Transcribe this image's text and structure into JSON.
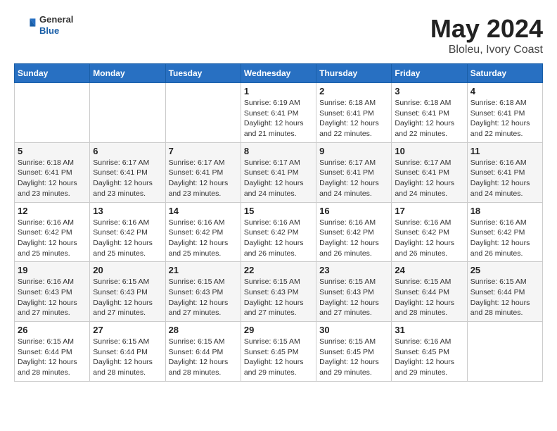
{
  "header": {
    "logo_general": "General",
    "logo_blue": "Blue",
    "title": "May 2024",
    "location": "Bloleu, Ivory Coast"
  },
  "weekdays": [
    "Sunday",
    "Monday",
    "Tuesday",
    "Wednesday",
    "Thursday",
    "Friday",
    "Saturday"
  ],
  "weeks": [
    [
      null,
      null,
      null,
      {
        "day": 1,
        "sunrise": "6:19 AM",
        "sunset": "6:41 PM",
        "daylight": "12 hours and 21 minutes."
      },
      {
        "day": 2,
        "sunrise": "6:18 AM",
        "sunset": "6:41 PM",
        "daylight": "12 hours and 22 minutes."
      },
      {
        "day": 3,
        "sunrise": "6:18 AM",
        "sunset": "6:41 PM",
        "daylight": "12 hours and 22 minutes."
      },
      {
        "day": 4,
        "sunrise": "6:18 AM",
        "sunset": "6:41 PM",
        "daylight": "12 hours and 22 minutes."
      }
    ],
    [
      {
        "day": 5,
        "sunrise": "6:18 AM",
        "sunset": "6:41 PM",
        "daylight": "12 hours and 23 minutes."
      },
      {
        "day": 6,
        "sunrise": "6:17 AM",
        "sunset": "6:41 PM",
        "daylight": "12 hours and 23 minutes."
      },
      {
        "day": 7,
        "sunrise": "6:17 AM",
        "sunset": "6:41 PM",
        "daylight": "12 hours and 23 minutes."
      },
      {
        "day": 8,
        "sunrise": "6:17 AM",
        "sunset": "6:41 PM",
        "daylight": "12 hours and 24 minutes."
      },
      {
        "day": 9,
        "sunrise": "6:17 AM",
        "sunset": "6:41 PM",
        "daylight": "12 hours and 24 minutes."
      },
      {
        "day": 10,
        "sunrise": "6:17 AM",
        "sunset": "6:41 PM",
        "daylight": "12 hours and 24 minutes."
      },
      {
        "day": 11,
        "sunrise": "6:16 AM",
        "sunset": "6:41 PM",
        "daylight": "12 hours and 24 minutes."
      }
    ],
    [
      {
        "day": 12,
        "sunrise": "6:16 AM",
        "sunset": "6:42 PM",
        "daylight": "12 hours and 25 minutes."
      },
      {
        "day": 13,
        "sunrise": "6:16 AM",
        "sunset": "6:42 PM",
        "daylight": "12 hours and 25 minutes."
      },
      {
        "day": 14,
        "sunrise": "6:16 AM",
        "sunset": "6:42 PM",
        "daylight": "12 hours and 25 minutes."
      },
      {
        "day": 15,
        "sunrise": "6:16 AM",
        "sunset": "6:42 PM",
        "daylight": "12 hours and 26 minutes."
      },
      {
        "day": 16,
        "sunrise": "6:16 AM",
        "sunset": "6:42 PM",
        "daylight": "12 hours and 26 minutes."
      },
      {
        "day": 17,
        "sunrise": "6:16 AM",
        "sunset": "6:42 PM",
        "daylight": "12 hours and 26 minutes."
      },
      {
        "day": 18,
        "sunrise": "6:16 AM",
        "sunset": "6:42 PM",
        "daylight": "12 hours and 26 minutes."
      }
    ],
    [
      {
        "day": 19,
        "sunrise": "6:16 AM",
        "sunset": "6:43 PM",
        "daylight": "12 hours and 27 minutes."
      },
      {
        "day": 20,
        "sunrise": "6:15 AM",
        "sunset": "6:43 PM",
        "daylight": "12 hours and 27 minutes."
      },
      {
        "day": 21,
        "sunrise": "6:15 AM",
        "sunset": "6:43 PM",
        "daylight": "12 hours and 27 minutes."
      },
      {
        "day": 22,
        "sunrise": "6:15 AM",
        "sunset": "6:43 PM",
        "daylight": "12 hours and 27 minutes."
      },
      {
        "day": 23,
        "sunrise": "6:15 AM",
        "sunset": "6:43 PM",
        "daylight": "12 hours and 27 minutes."
      },
      {
        "day": 24,
        "sunrise": "6:15 AM",
        "sunset": "6:44 PM",
        "daylight": "12 hours and 28 minutes."
      },
      {
        "day": 25,
        "sunrise": "6:15 AM",
        "sunset": "6:44 PM",
        "daylight": "12 hours and 28 minutes."
      }
    ],
    [
      {
        "day": 26,
        "sunrise": "6:15 AM",
        "sunset": "6:44 PM",
        "daylight": "12 hours and 28 minutes."
      },
      {
        "day": 27,
        "sunrise": "6:15 AM",
        "sunset": "6:44 PM",
        "daylight": "12 hours and 28 minutes."
      },
      {
        "day": 28,
        "sunrise": "6:15 AM",
        "sunset": "6:44 PM",
        "daylight": "12 hours and 28 minutes."
      },
      {
        "day": 29,
        "sunrise": "6:15 AM",
        "sunset": "6:45 PM",
        "daylight": "12 hours and 29 minutes."
      },
      {
        "day": 30,
        "sunrise": "6:15 AM",
        "sunset": "6:45 PM",
        "daylight": "12 hours and 29 minutes."
      },
      {
        "day": 31,
        "sunrise": "6:16 AM",
        "sunset": "6:45 PM",
        "daylight": "12 hours and 29 minutes."
      },
      null
    ]
  ],
  "labels": {
    "sunrise": "Sunrise:",
    "sunset": "Sunset:",
    "daylight": "Daylight hours"
  }
}
